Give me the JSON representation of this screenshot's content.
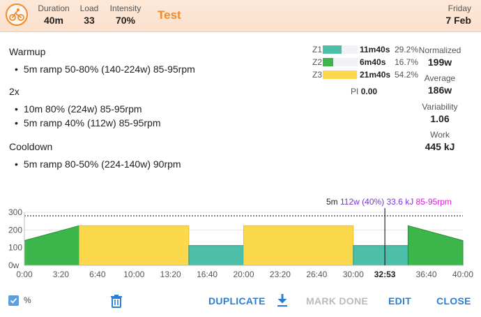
{
  "header": {
    "duration_label": "Duration",
    "duration_value": "40m",
    "load_label": "Load",
    "load_value": "33",
    "intensity_label": "Intensity",
    "intensity_value": "70%",
    "title": "Test",
    "day": "Friday",
    "date": "7 Feb",
    "icon": "cyclist-icon"
  },
  "description": {
    "warmup_title": "Warmup",
    "warmup_step": "5m ramp 50-80% (140-224w) 85-95rpm",
    "repeat_title": "2x",
    "repeat_step1": "10m 80% (224w) 85-95rpm",
    "repeat_step2": "5m ramp 40% (112w) 85-95rpm",
    "cooldown_title": "Cooldown",
    "cooldown_step": "5m ramp 80-50% (224-140w) 90rpm"
  },
  "zones": [
    {
      "name": "Z1",
      "time": "11m40s",
      "percent": "29.2%",
      "fraction": 0.292,
      "color": "#4dbfa8"
    },
    {
      "name": "Z2",
      "time": "6m40s",
      "percent": "16.7%",
      "fraction": 0.167,
      "color": "#3cb54a"
    },
    {
      "name": "Z3",
      "time": "21m40s",
      "percent": "54.2%",
      "fraction": 0.542,
      "color": "#fcd84c"
    }
  ],
  "pi": {
    "label": "PI",
    "value": "0.00"
  },
  "metrics": {
    "normalized_label": "Normalized",
    "normalized_value": "199w",
    "average_label": "Average",
    "average_value": "186w",
    "variability_label": "Variability",
    "variability_value": "1.06",
    "work_label": "Work",
    "work_value": "445 kJ"
  },
  "hover": {
    "duration": "5m",
    "power": "112w (40%)",
    "energy": "33.6 kJ",
    "cadence": "85-95rpm",
    "power_color": "#7b35d6",
    "cadence_color": "#d81bd8"
  },
  "chart_data": {
    "type": "area",
    "x_unit": "minutes",
    "xlim": [
      0,
      40
    ],
    "ylim": [
      0,
      300
    ],
    "y_ticks": [
      "0w",
      "100",
      "200",
      "300"
    ],
    "x_ticks": [
      "0:00",
      "3:20",
      "6:40",
      "10:00",
      "13:20",
      "16:40",
      "20:00",
      "23:20",
      "26:40",
      "30:00",
      "33:20",
      "36:40",
      "40:00"
    ],
    "x_tick_values": [
      0,
      3.333,
      6.667,
      10,
      13.333,
      16.667,
      20,
      23.333,
      26.667,
      30,
      33.333,
      36.667,
      40
    ],
    "ftp_line": 280,
    "cursor_x": 32.883,
    "cursor_label": "32:53",
    "segments": [
      {
        "start": 0,
        "end": 5,
        "from": 140,
        "to": 224,
        "zone": "Z2"
      },
      {
        "start": 5,
        "end": 15,
        "from": 224,
        "to": 224,
        "zone": "Z3"
      },
      {
        "start": 15,
        "end": 20,
        "from": 112,
        "to": 112,
        "zone": "Z1"
      },
      {
        "start": 20,
        "end": 30,
        "from": 224,
        "to": 224,
        "zone": "Z3"
      },
      {
        "start": 30,
        "end": 35,
        "from": 112,
        "to": 112,
        "zone": "Z1"
      },
      {
        "start": 35,
        "end": 40,
        "from": 224,
        "to": 140,
        "zone": "Z2"
      }
    ]
  },
  "toolbar": {
    "percent_label": "%",
    "duplicate": "DUPLICATE",
    "mark_done": "MARK DONE",
    "edit": "EDIT",
    "close": "CLOSE"
  }
}
